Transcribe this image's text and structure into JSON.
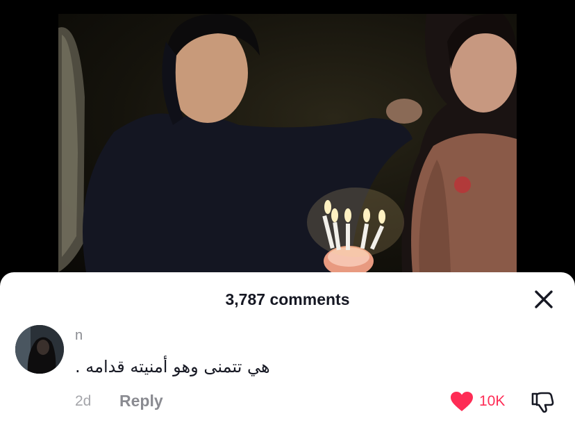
{
  "sheet": {
    "title": "3,787 comments"
  },
  "comment": {
    "username": "n",
    "text": "هي تتمنى وهو أمنيته قدامه .",
    "time": "2d",
    "reply_label": "Reply",
    "like_count": "10K",
    "liked": true
  },
  "colors": {
    "like_active": "#fe2c55",
    "text_primary": "#161823",
    "text_secondary": "#8a8b91",
    "sheet_bg": "#ffffff"
  },
  "icons": {
    "close": "close-icon",
    "like": "heart-icon",
    "dislike": "thumbs-down-icon"
  }
}
